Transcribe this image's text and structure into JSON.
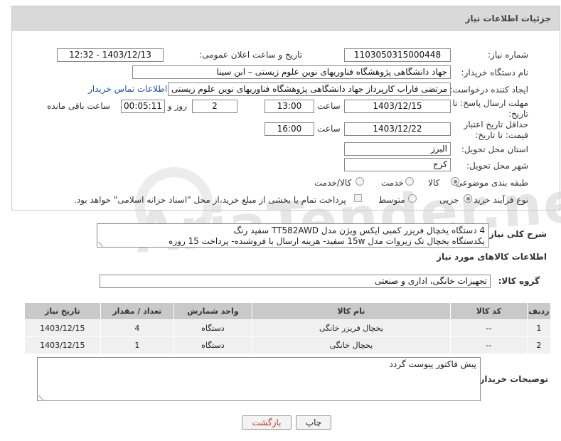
{
  "header": {
    "title": "جزئیات اطلاعات نیاز"
  },
  "fields": {
    "need_number_label": "شماره نیاز:",
    "need_number": "1103050315000448",
    "announce_label": "تاریخ و ساعت اعلان عمومی:",
    "announce_value": "1403/12/13 - 12:32",
    "buyer_org_label": "نام دستگاه خریدار:",
    "buyer_org": "جهاد دانشگاهی پژوهشگاه فناوریهای نوین علوم زیستی – ابن سینا",
    "requester_label": "ایجاد کننده درخواست:",
    "requester": "مرتضی فاراب کارپرداز جهاد دانشگاهی پژوهشگاه فناوریهای نوین علوم زیستی – ابن",
    "contact_link": "اطلاعات تماس خریدار",
    "reply_deadline_label": "مهلت ارسال پاسخ: تا تاریخ:",
    "reply_date": "1403/12/15",
    "time_label": "ساعت",
    "reply_time": "13:00",
    "days_value": "2",
    "days_label": "روز و",
    "remaining_value": "00:05:11",
    "remaining_label": "ساعت باقی مانده",
    "price_validity_label": "حداقل تاریخ اعتبار قیمت: تا تاریخ:",
    "price_date": "1403/12/22",
    "price_time": "16:00",
    "province_label": "استان محل تحویل:",
    "province": "البرز",
    "city_label": "شهر محل تحویل:",
    "city": "کرج",
    "category_label": "طبقه بندی موضوعی:",
    "category_options": [
      "کالا",
      "خدمت",
      "کالا/خدمت"
    ],
    "process_label": "نوع فرآیند خرید :",
    "process_options": [
      "جزیی",
      "متوسط"
    ],
    "payment_note": "پرداخت تمام یا بخشی از مبلغ خرید،از محل \"اسناد خزانه اسلامی\" خواهد بود."
  },
  "summary": {
    "label": "شرح کلی نیاز:",
    "line1": "4 دستگاه یخچال فریزر کمبی ایکس ویژن مدل TT582AWD سفید رنگ",
    "line2": "یکدستگاه یخچال تک زیروات مدل 15w سفید- هزینه ارسال با فروشنده- پرداخت 15 روزه"
  },
  "goods": {
    "section_title": "اطلاعات کالاهای مورد نیاز",
    "group_label": "گروه کالا:",
    "group_value": "تجهیزات خانگی، اداری و صنعتی",
    "columns": [
      "ردیف",
      "کد کالا",
      "نام کالا",
      "واحد شمارش",
      "تعداد / مقدار",
      "تاریخ نیاز"
    ],
    "rows": [
      [
        "1",
        "--",
        "یخچال فریزر خانگی",
        "دستگاه",
        "4",
        "1403/12/15"
      ],
      [
        "2",
        "--",
        "یخچال خانگی",
        "دستگاه",
        "1",
        "1403/12/15"
      ]
    ]
  },
  "buyer_notes": {
    "label": "توضیحات خریدار:",
    "text": "پیش فاکتور پیوست گردد"
  },
  "buttons": {
    "print": "چاپ",
    "back": "بازگشت"
  },
  "colors": {
    "header_bg": "#d9d9d9",
    "table_header": "#c9c9c9",
    "link": "#1d4fb0",
    "back_text": "#c0392b"
  }
}
